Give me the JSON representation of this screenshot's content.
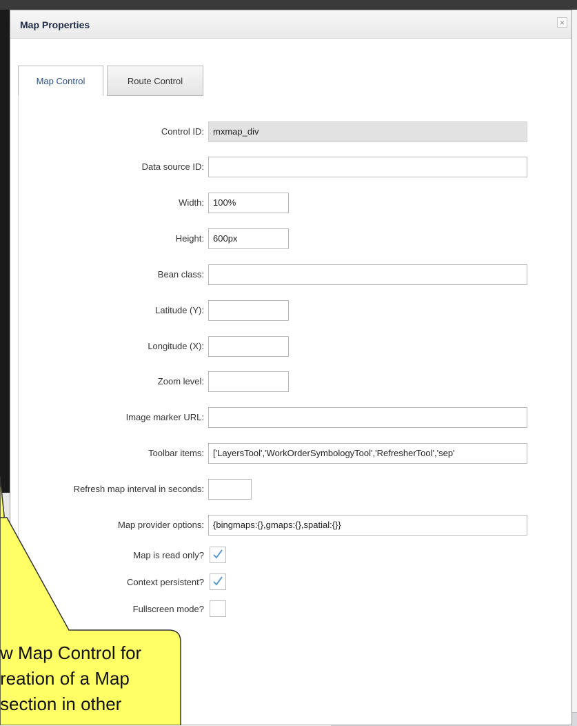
{
  "dialog": {
    "title": "Map Properties",
    "close_label": "×"
  },
  "tabs": [
    {
      "label": "Map Control",
      "active": true
    },
    {
      "label": "Route Control",
      "active": false
    }
  ],
  "fields": {
    "control_id": {
      "label": "Control ID:",
      "value": "mxmap_div"
    },
    "data_source_id": {
      "label": "Data source ID:",
      "value": ""
    },
    "width": {
      "label": "Width:",
      "value": "100%"
    },
    "height": {
      "label": "Height:",
      "value": "600px"
    },
    "bean_class": {
      "label": "Bean class:",
      "value": ""
    },
    "latitude": {
      "label": "Latitude (Y):",
      "value": ""
    },
    "longitude": {
      "label": "Longitude (X):",
      "value": ""
    },
    "zoom_level": {
      "label": "Zoom level:",
      "value": ""
    },
    "image_marker_url": {
      "label": "Image marker URL:",
      "value": ""
    },
    "toolbar_items": {
      "label": "Toolbar items:",
      "value": "['LayersTool','WorkOrderSymbologyTool','RefresherTool','sep'"
    },
    "refresh_interval": {
      "label": "Refresh map interval in seconds:",
      "value": ""
    },
    "map_provider_options": {
      "label": "Map provider options:",
      "value": "{bingmaps:{},gmaps:{},spatial:{}}"
    }
  },
  "checkboxes": {
    "read_only": {
      "label": "Map is read only?",
      "checked": true
    },
    "context_persistent": {
      "label": "Context persistent?",
      "checked": true
    },
    "fullscreen": {
      "label": "Fullscreen mode?",
      "checked": false
    }
  },
  "callout": {
    "line1": "w Map Control for",
    "line2": "reation of a Map",
    "line3": "section in other"
  },
  "colors": {
    "callout_fill": "#ffff66",
    "check_color": "#5b9bd5",
    "tab_active_text": "#2b4e80"
  }
}
